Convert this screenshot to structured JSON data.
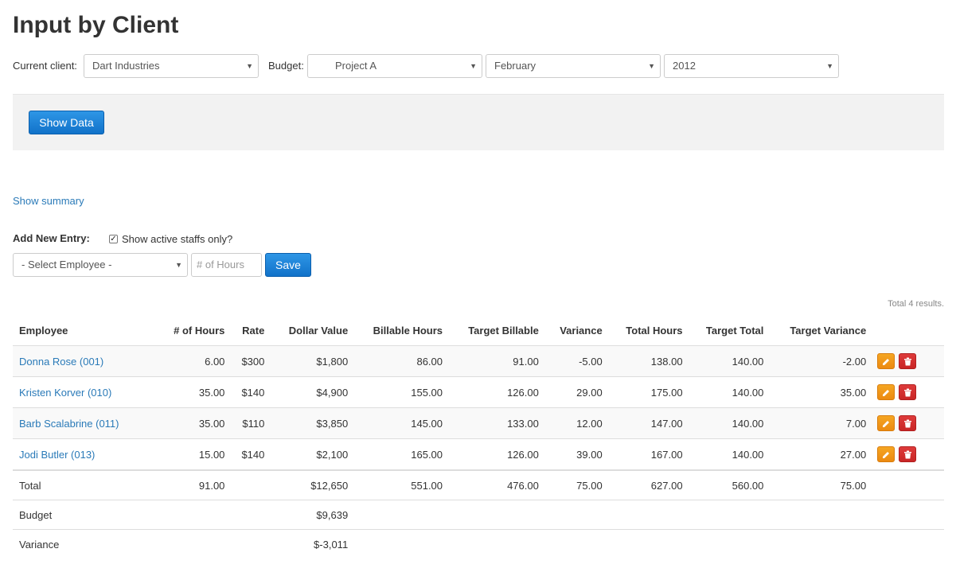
{
  "page": {
    "title": "Input by Client"
  },
  "filters": {
    "client_label": "Current client:",
    "client_value": "Dart Industries",
    "budget_label": "Budget:",
    "budget_value": "Project A",
    "month_value": "February",
    "year_value": "2012"
  },
  "actions": {
    "show_data": "Show Data",
    "show_summary": "Show summary"
  },
  "add_entry": {
    "label": "Add New Entry:",
    "active_only_label": "Show active staffs only?",
    "active_only_checked": true,
    "employee_placeholder": "- Select Employee -",
    "hours_placeholder": "# of Hours",
    "save_label": "Save"
  },
  "results_text": "Total 4 results.",
  "table": {
    "columns": [
      "Employee",
      "# of Hours",
      "Rate",
      "Dollar Value",
      "Billable Hours",
      "Target Billable",
      "Variance",
      "Total Hours",
      "Target Total",
      "Target Variance"
    ],
    "rows": [
      {
        "employee": "Donna Rose (001)",
        "hours": "6.00",
        "rate": "$300",
        "dollar": "$1,800",
        "billable": "86.00",
        "target_billable": "91.00",
        "variance": "-5.00",
        "total_hours": "138.00",
        "target_total": "140.00",
        "target_variance": "-2.00"
      },
      {
        "employee": "Kristen Korver (010)",
        "hours": "35.00",
        "rate": "$140",
        "dollar": "$4,900",
        "billable": "155.00",
        "target_billable": "126.00",
        "variance": "29.00",
        "total_hours": "175.00",
        "target_total": "140.00",
        "target_variance": "35.00"
      },
      {
        "employee": "Barb Scalabrine (011)",
        "hours": "35.00",
        "rate": "$110",
        "dollar": "$3,850",
        "billable": "145.00",
        "target_billable": "133.00",
        "variance": "12.00",
        "total_hours": "147.00",
        "target_total": "140.00",
        "target_variance": "7.00"
      },
      {
        "employee": "Jodi Butler (013)",
        "hours": "15.00",
        "rate": "$140",
        "dollar": "$2,100",
        "billable": "165.00",
        "target_billable": "126.00",
        "variance": "39.00",
        "total_hours": "167.00",
        "target_total": "140.00",
        "target_variance": "27.00"
      }
    ],
    "total": {
      "label": "Total",
      "hours": "91.00",
      "dollar": "$12,650",
      "billable": "551.00",
      "target_billable": "476.00",
      "variance": "75.00",
      "total_hours": "627.00",
      "target_total": "560.00",
      "target_variance": "75.00"
    },
    "budget": {
      "label": "Budget",
      "dollar": "$9,639"
    },
    "variance_row": {
      "label": "Variance",
      "dollar": "$-3,011"
    }
  },
  "icons": {
    "edit": "pencil-icon",
    "delete": "trash-icon",
    "dropdown": "caret-down-icon",
    "check": "checkmark-icon"
  },
  "colors": {
    "primary": "#1a7fd6",
    "link": "#2a7ab8",
    "edit": "#f0961b",
    "delete": "#d43131",
    "panel": "#f2f2f2"
  }
}
